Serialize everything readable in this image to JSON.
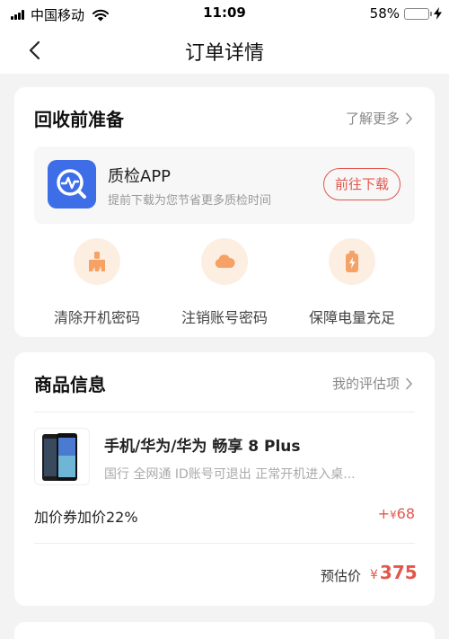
{
  "status_bar": {
    "carrier": "中国移动",
    "time": "11:09",
    "battery_percent": "58%",
    "battery_level": 0.58,
    "battery_color": "#f0c419"
  },
  "nav": {
    "title": "订单详情",
    "back_icon": "chevron-left-icon"
  },
  "prep": {
    "title": "回收前准备",
    "link": "了解更多",
    "app": {
      "name": "质检APP",
      "desc": "提前下载为您节省更多质检时间",
      "button": "前往下载",
      "icon": "inspection-app-icon",
      "icon_color": "#3d6ee8"
    },
    "items": [
      {
        "label": "清除开机密码",
        "icon": "broom-icon"
      },
      {
        "label": "注销账号密码",
        "icon": "cloud-icon"
      },
      {
        "label": "保障电量充足",
        "icon": "battery-icon"
      }
    ]
  },
  "product": {
    "title": "商品信息",
    "link": "我的评估项",
    "name": "手机/华为/华为 畅享 8 Plus",
    "tags": "国行 全网通 ID账号可退出 正常开机进入桌...",
    "coupon_label": "加价券加价22%",
    "coupon_prefix": "+",
    "coupon_currency": "¥",
    "coupon_amount": "68",
    "estimate_label": "预估价",
    "estimate_currency": "¥",
    "estimate_amount": "375"
  },
  "colors": {
    "accent": "#e3564c",
    "background": "#f3f3f3",
    "icon_bg": "#fdeee2",
    "icon_fg": "#f6a266"
  }
}
